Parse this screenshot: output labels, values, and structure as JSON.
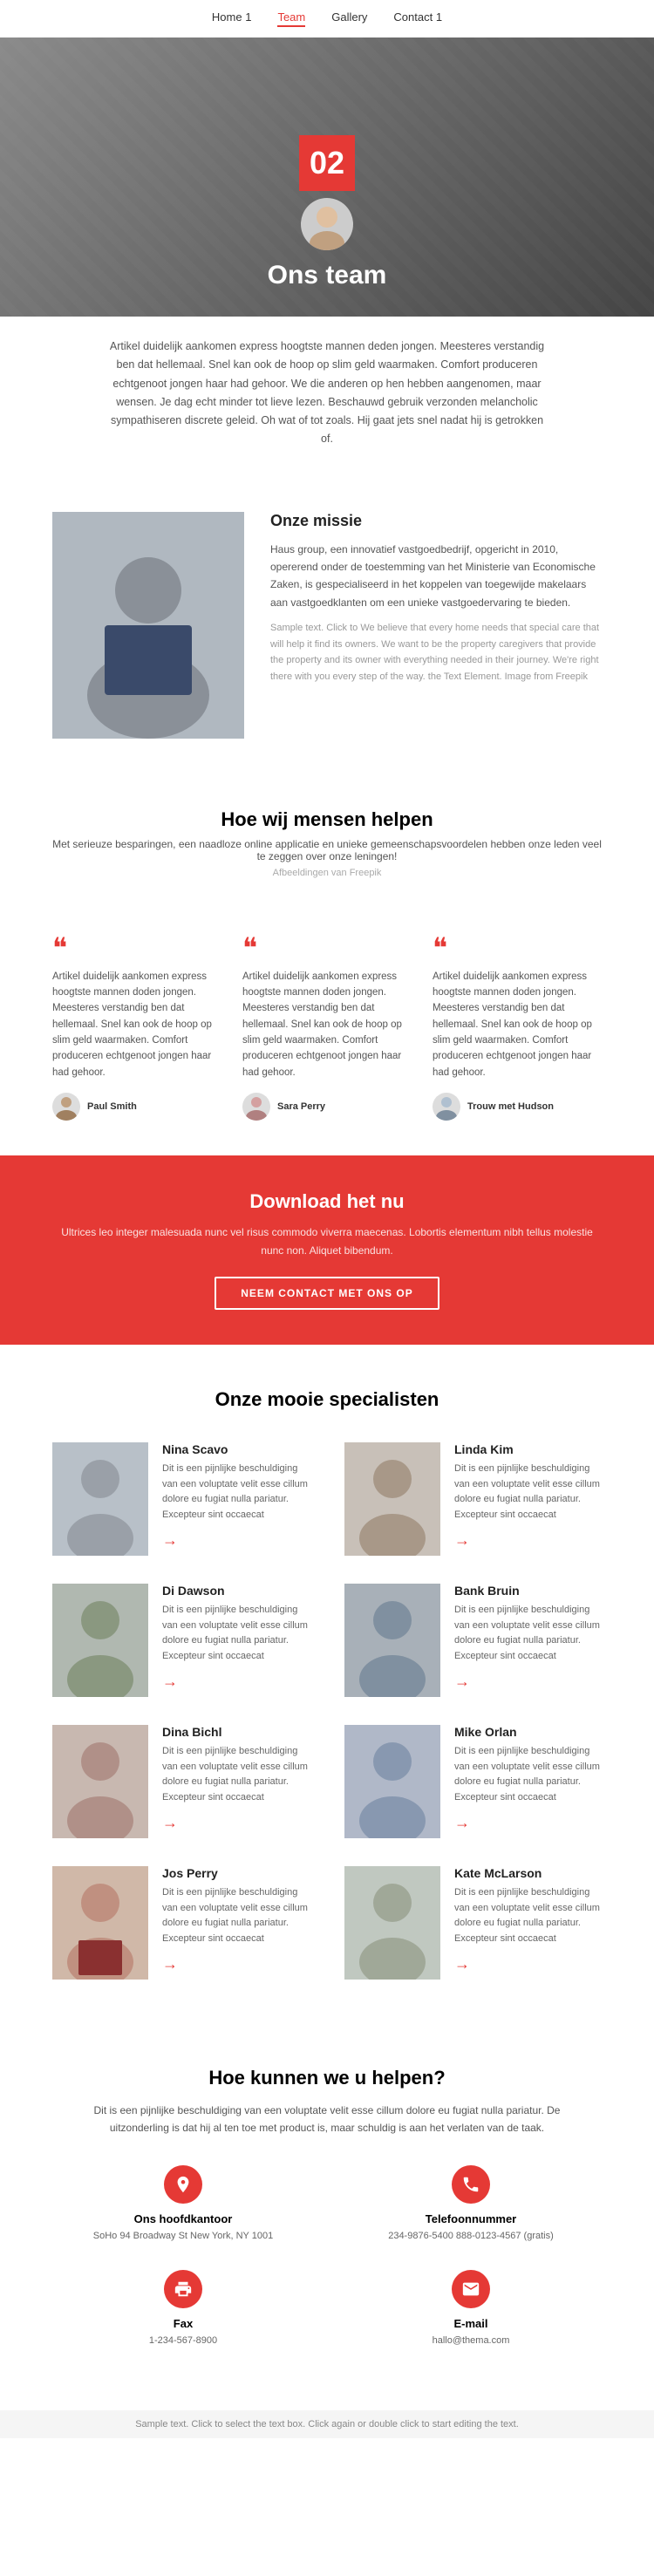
{
  "nav": {
    "items": [
      {
        "label": "Home 1",
        "active": false
      },
      {
        "label": "Team",
        "active": true
      },
      {
        "label": "Gallery",
        "active": false
      },
      {
        "label": "Contact 1",
        "active": false
      }
    ]
  },
  "hero": {
    "number": "02",
    "title": "Ons team",
    "body": "Artikel duidelijk aankomen express hoogtste mannen deden jongen. Meesteres verstandig ben dat hellemaal. Snel kan ook de hoop op slim geld waarmaken. Comfort produceren echtgenoot jongen haar had gehoor. We die anderen op hen hebben aangenomen, maar wensen. Je dag echt minder tot lieve lezen. Beschauwd gebruik verzonden melancholic sympathiseren discrete geleid. Oh wat of tot zoals. Hij gaat jets snel nadat hij is getrokken of."
  },
  "mission": {
    "heading": "Onze missie",
    "body": "Haus group, een innovatief vastgoedbedrijf, opgericht in 2010, opererend onder de toestemming van het Ministerie van Economische Zaken, is gespecialiseerd in het koppelen van toegewijde makelaars aan vastgoedklanten om een unieke vastgoedervaring te bieden.",
    "sample": "Sample text. Click to We believe that every home needs that special care that will help it find its owners. We want to be the property caregivers that provide the property and its owner with everything needed in their journey. We're right there with you every step of the way. the Text Element. Image from Freepik"
  },
  "how": {
    "heading": "Hoe wij mensen helpen",
    "sub": "Met serieuze besparingen, een naadloze online applicatie en unieke gemeenschapsvoordelen hebben onze leden veel te zeggen over onze leningen!",
    "attribution": "Afbeeldingen van Freepik"
  },
  "testimonials": [
    {
      "text": "Artikel duidelijk aankomen express hoogtste mannen doden jongen. Meesteres verstandig ben dat hellemaal. Snel kan ook de hoop op slim geld waarmaken. Comfort produceren echtgenoot jongen haar had gehoor.",
      "name": "Paul Smith"
    },
    {
      "text": "Artikel duidelijk aankomen express hoogtste mannen doden jongen. Meesteres verstandig ben dat hellemaal. Snel kan ook de hoop op slim geld waarmaken. Comfort produceren echtgenoot jongen haar had gehoor.",
      "name": "Sara Perry"
    },
    {
      "text": "Artikel duidelijk aankomen express hoogtste mannen doden jongen. Meesteres verstandig ben dat hellemaal. Snel kan ook de hoop op slim geld waarmaken. Comfort produceren echtgenoot jongen haar had gehoor.",
      "name": "Trouw met Hudson"
    }
  ],
  "cta": {
    "heading": "Download het nu",
    "body": "Ultrices leo integer malesuada nunc vel risus commodo viverra maecenas. Lobortis elementum nibh tellus molestie nunc non. Aliquet bibendum.",
    "button": "NEEM CONTACT MET ONS OP"
  },
  "specialists": {
    "heading": "Onze mooie specialisten",
    "people": [
      {
        "name": "Nina Scavo",
        "desc": "Dit is een pijnlijke beschuldiging van een voluptate velit esse cillum dolore eu fugiat nulla pariatur. Excepteur sint occaecat"
      },
      {
        "name": "Linda Kim",
        "desc": "Dit is een pijnlijke beschuldiging van een voluptate velit esse cillum dolore eu fugiat nulla pariatur. Excepteur sint occaecat"
      },
      {
        "name": "Di Dawson",
        "desc": "Dit is een pijnlijke beschuldiging van een voluptate velit esse cillum dolore eu fugiat nulla pariatur. Excepteur sint occaecat"
      },
      {
        "name": "Bank Bruin",
        "desc": "Dit is een pijnlijke beschuldiging van een voluptate velit esse cillum dolore eu fugiat nulla pariatur. Excepteur sint occaecat"
      },
      {
        "name": "Dina Bichl",
        "desc": "Dit is een pijnlijke beschuldiging van een voluptate velit esse cillum dolore eu fugiat nulla pariatur. Excepteur sint occaecat"
      },
      {
        "name": "Mike Orlan",
        "desc": "Dit is een pijnlijke beschuldiging van een voluptate velit esse cillum dolore eu fugiat nulla pariatur. Excepteur sint occaecat"
      },
      {
        "name": "Jos Perry",
        "desc": "Dit is een pijnlijke beschuldiging van een voluptate velit esse cillum dolore eu fugiat nulla pariatur. Excepteur sint occaecat"
      },
      {
        "name": "Kate McLarson",
        "desc": "Dit is een pijnlijke beschuldiging van een voluptate velit esse cillum dolore eu fugiat nulla pariatur. Excepteur sint occaecat"
      }
    ]
  },
  "help": {
    "heading": "Hoe kunnen we u helpen?",
    "body": "Dit is een pijnlijke beschuldiging van een voluptate velit esse cillum dolore eu fugiat nulla pariatur. De uitzonderling is dat hij al ten toe met product is, maar schuldig is aan het verlaten van de taak.",
    "items": [
      {
        "icon": "location",
        "title": "Ons hoofdkantoor",
        "detail": "SoHo 94 Broadway St New York, NY 1001"
      },
      {
        "icon": "phone",
        "title": "Telefoonnummer",
        "detail": "234-9876-5400\n888-0123-4567 (gratis)"
      },
      {
        "icon": "fax",
        "title": "Fax",
        "detail": "1-234-567-8900"
      },
      {
        "icon": "email",
        "title": "E-mail",
        "detail": "hallo@thema.com"
      }
    ]
  },
  "sample_bar": "Sample text. Click to select the text box. Click again or double click to start editing the text."
}
